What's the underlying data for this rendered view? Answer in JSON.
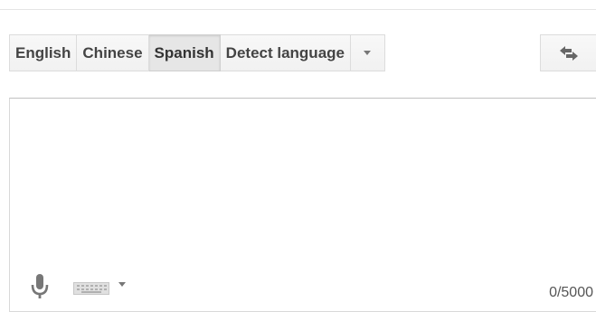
{
  "source_languages": [
    {
      "label": "English",
      "selected": false
    },
    {
      "label": "Chinese",
      "selected": false
    },
    {
      "label": "Spanish",
      "selected": true
    },
    {
      "label": "Detect language",
      "selected": false
    }
  ],
  "more_languages_icon": "chevron-down-icon",
  "swap_icon": "swap-arrows-icon",
  "source_text": {
    "value": "",
    "placeholder": ""
  },
  "input_tools": {
    "mic_icon": "microphone-icon",
    "keyboard_icon": "keyboard-icon"
  },
  "char_count": "0/5000",
  "colors": {
    "button_bg": "#f5f5f5",
    "selected_bg": "#e6e6e6",
    "border": "#dcdcdc",
    "icon": "#777777"
  }
}
